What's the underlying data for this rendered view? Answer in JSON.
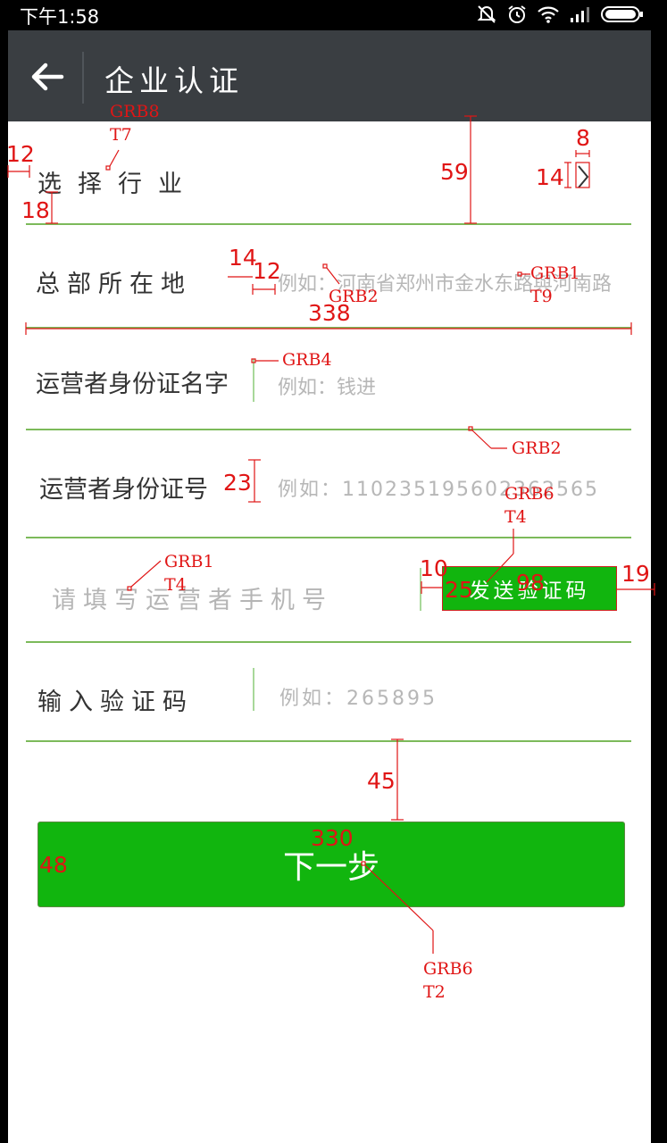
{
  "status_bar": {
    "time": "下午1:58",
    "icons": [
      "mute-icon",
      "alarm-icon",
      "wifi-icon",
      "signal-icon",
      "battery-icon"
    ]
  },
  "app_bar": {
    "title": "企业认证",
    "back_icon": "back-arrow-icon"
  },
  "form": {
    "industry": {
      "label": "选择行业"
    },
    "location": {
      "label": "总部所在地",
      "placeholder": "例如：河南省郑州市金水东路與河南路"
    },
    "operator_name": {
      "label": "运营者身份证名字",
      "placeholder": "例如：钱进"
    },
    "operator_id": {
      "label": "运营者身份证号",
      "placeholder": "例如：110235195602362565"
    },
    "phone": {
      "placeholder": "请填写运营者手机号",
      "send_code_label": "发送验证码"
    },
    "code": {
      "label": "输入验证码",
      "placeholder": "例如：265895"
    },
    "next_label": "下一步"
  },
  "annotations": {
    "grb8": "GRB8",
    "t7": "T7",
    "n12a": "12",
    "n18": "18",
    "n59": "59",
    "n8": "8",
    "n14a": "14",
    "n14b": "14",
    "n12b": "12",
    "grb2a": "GRB2",
    "grb1a": "GRB1",
    "t9": "T9",
    "n338": "338",
    "grb4": "GRB4",
    "grb2b": "GRB2",
    "n23": "23",
    "grb6a": "GRB6",
    "t4a": "T4",
    "grb1b": "GRB1",
    "t4b": "T4",
    "n10": "10",
    "n25": "25",
    "n98": "98",
    "n19": "19",
    "n45": "45",
    "n330": "330",
    "n48": "48",
    "grb6b": "GRB6",
    "t2": "T2"
  },
  "colors": {
    "app_bar": "#3a3e42",
    "accent_green": "#11b50e",
    "divider_green": "#7cba5a",
    "annotation_red": "#e01515"
  }
}
